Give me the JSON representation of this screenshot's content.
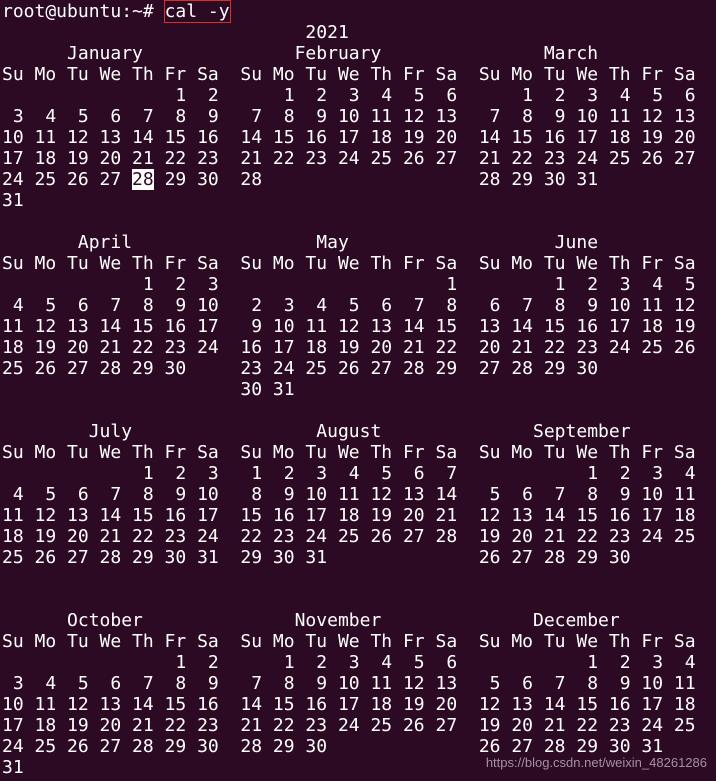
{
  "terminal": {
    "background": "#2c0a23",
    "foreground": "#ffffff",
    "prompt": "root@ubuntu:~# ",
    "command": "cal -y",
    "command_box_color": "#d93025",
    "highlighted_day": "28",
    "highlighted_month": "January",
    "lines": [
      "                            2021",
      "      January              February               March",
      "Su Mo Tu We Th Fr Sa  Su Mo Tu We Th Fr Sa  Su Mo Tu We Th Fr Sa",
      "                1  2      1  2  3  4  5  6      1  2  3  4  5  6",
      " 3  4  5  6  7  8  9   7  8  9 10 11 12 13   7  8  9 10 11 12 13",
      "10 11 12 13 14 15 16  14 15 16 17 18 19 20  14 15 16 17 18 19 20",
      "17 18 19 20 21 22 23  21 22 23 24 25 26 27  21 22 23 24 25 26 27",
      "24 25 26 27 28 29 30  28                    28 29 30 31",
      "31",
      "",
      "       April                 May                   June",
      "Su Mo Tu We Th Fr Sa  Su Mo Tu We Th Fr Sa  Su Mo Tu We Th Fr Sa",
      "             1  2  3                     1         1  2  3  4  5",
      " 4  5  6  7  8  9 10   2  3  4  5  6  7  8   6  7  8  9 10 11 12",
      "11 12 13 14 15 16 17   9 10 11 12 13 14 15  13 14 15 16 17 18 19",
      "18 19 20 21 22 23 24  16 17 18 19 20 21 22  20 21 22 23 24 25 26",
      "25 26 27 28 29 30     23 24 25 26 27 28 29  27 28 29 30",
      "                      30 31",
      "",
      "        July                 August              September",
      "Su Mo Tu We Th Fr Sa  Su Mo Tu We Th Fr Sa  Su Mo Tu We Th Fr Sa",
      "             1  2  3   1  2  3  4  5  6  7            1  2  3  4",
      " 4  5  6  7  8  9 10   8  9 10 11 12 13 14   5  6  7  8  9 10 11",
      "11 12 13 14 15 16 17  15 16 17 18 19 20 21  12 13 14 15 16 17 18",
      "18 19 20 21 22 23 24  22 23 24 25 26 27 28  19 20 21 22 23 24 25",
      "25 26 27 28 29 30 31  29 30 31              26 27 28 29 30",
      "",
      "",
      "      October              November              December",
      "Su Mo Tu We Th Fr Sa  Su Mo Tu We Th Fr Sa  Su Mo Tu We Th Fr Sa",
      "                1  2      1  2  3  4  5  6            1  2  3  4",
      " 3  4  5  6  7  8  9   7  8  9 10 11 12 13   5  6  7  8  9 10 11",
      "10 11 12 13 14 15 16  14 15 16 17 18 19 20  12 13 14 15 16 17 18",
      "17 18 19 20 21 22 23  21 22 23 24 25 26 27  19 20 21 22 23 24 25",
      "24 25 26 27 28 29 30  28 29 30              26 27 28 29 30 31",
      "31"
    ]
  },
  "watermark": "https://blog.csdn.net/weixin_48261286"
}
